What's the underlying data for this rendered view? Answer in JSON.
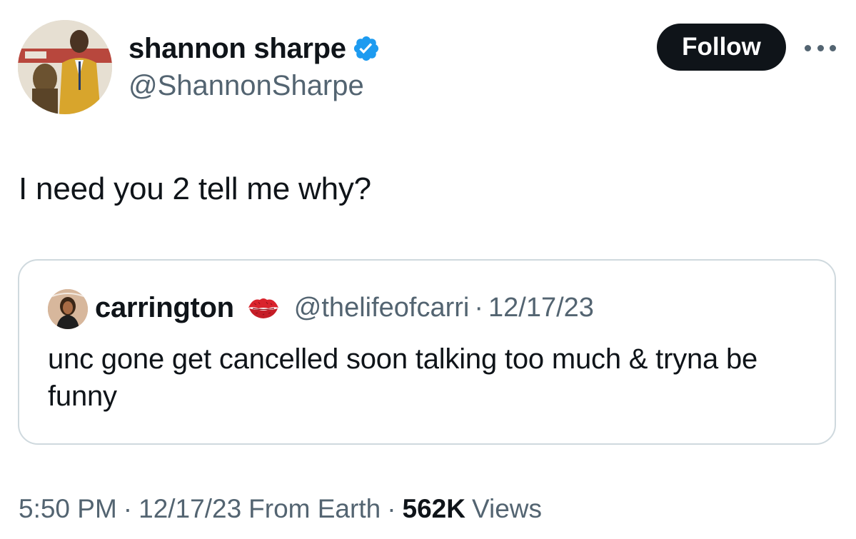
{
  "tweet": {
    "author": {
      "display_name": "shannon sharpe",
      "handle": "@ShannonSharpe",
      "verified": true,
      "verified_color": "#1d9bf0"
    },
    "follow_label": "Follow",
    "more_icon": "more-horizontal-icon",
    "text": "I need you 2 tell me why?",
    "quote": {
      "author_name": "carrington",
      "emoji": "kiss-mark-icon",
      "handle": "@thelifeofcarri",
      "separator": "·",
      "date": "12/17/23",
      "text": "unc gone get cancelled soon talking too much & tryna be funny"
    },
    "meta": {
      "time": "5:50 PM",
      "date": "12/17/23",
      "source": "From Earth",
      "separator": "·",
      "views_count": "562K",
      "views_label": "Views"
    }
  },
  "colors": {
    "text_primary": "#0f1419",
    "text_secondary": "#536471",
    "border": "#cfd9de",
    "follow_bg": "#0f1419",
    "kiss_red": "#d9232d"
  }
}
